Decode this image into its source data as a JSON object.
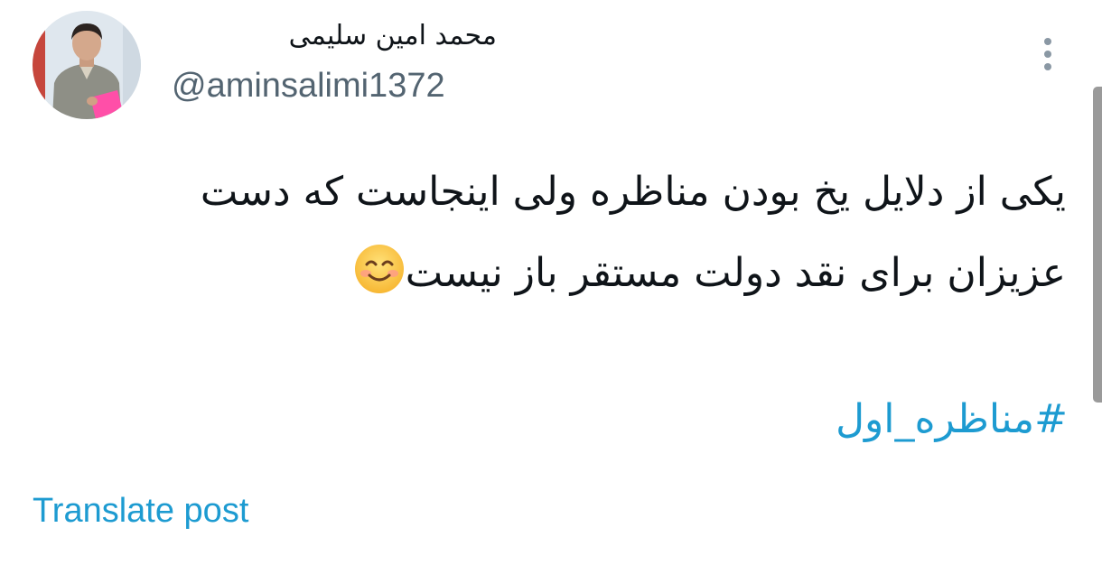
{
  "author": {
    "display_name": "محمد امین سلیمی",
    "handle": "@aminsalimi1372",
    "avatar_icon": "person-photo"
  },
  "menu": {
    "more_icon": "vertical-ellipsis-icon"
  },
  "post": {
    "text_lines": [
      "یکی از دلایل یخ بودن مناظره ولی اینجاست که دست",
      "عزیزان برای نقد دولت مستقر باز نیست"
    ],
    "emoji": "smiling-face-icon",
    "hashtag": "#مناظره_اول",
    "translate_label": "Translate post"
  },
  "colors": {
    "link": "#1d9bd1",
    "secondary_text": "#536471",
    "primary_text": "#0f1419"
  }
}
